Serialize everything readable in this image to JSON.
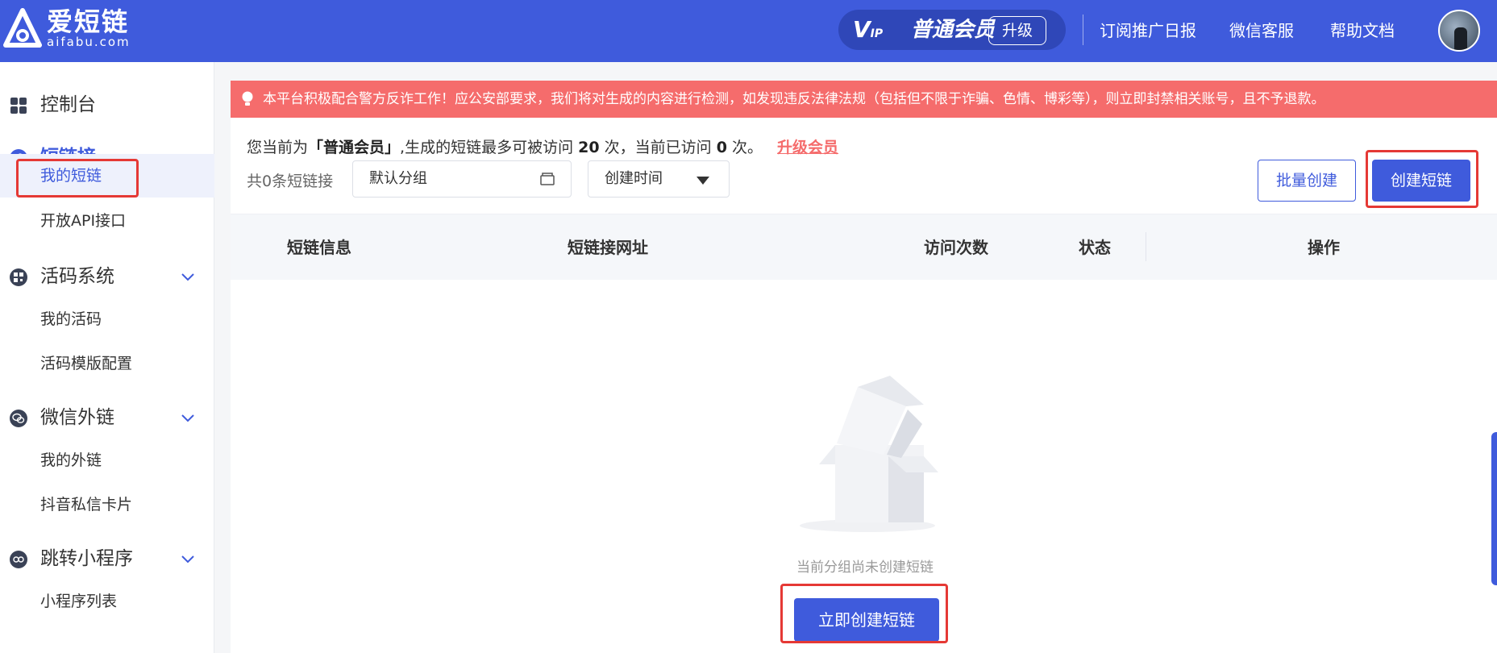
{
  "header": {
    "logo_cn": "爱短链",
    "logo_en": "aifabu.com",
    "vip_badge": "V",
    "vip_badge_small": "IP",
    "member_level": "普通会员",
    "upgrade_label": "升级",
    "links": [
      "订阅推广日报",
      "微信客服",
      "帮助文档"
    ]
  },
  "sidebar": {
    "groups": [
      {
        "label": "控制台",
        "icon": "dashboard-icon"
      },
      {
        "label": "短链接",
        "icon": "link-icon",
        "active": true,
        "items": [
          "我的短链",
          "开放API接口"
        ]
      },
      {
        "label": "活码系统",
        "icon": "qrcode-icon",
        "items": [
          "我的活码",
          "活码模版配置"
        ]
      },
      {
        "label": "微信外链",
        "icon": "wechat-icon",
        "items": [
          "我的外链",
          "抖音私信卡片"
        ]
      },
      {
        "label": "跳转小程序",
        "icon": "miniprogram-icon",
        "items": [
          "小程序列表"
        ]
      }
    ]
  },
  "notice": {
    "text": "本平台积极配合警方反诈工作！应公安部要求，我们将对生成的内容进行检测，如发现违反法律法规（包括但不限于诈骗、色情、博彩等），则立即封禁相关账号，且不予退款。"
  },
  "main": {
    "info_prefix": "您当前为",
    "info_level": "「普通会员」",
    "info_mid": ",生成的短链最多可被访问",
    "info_max": "20",
    "info_mid2": "次，当前已访问",
    "info_used": "0",
    "info_suffix": "次。",
    "upgrade_link": "升级会员",
    "count_label": "共0条短链接",
    "group_select": "默认分组",
    "sort_select": "创建时间",
    "batch_create": "批量创建",
    "create": "创建短链",
    "columns": [
      "短链信息",
      "短链接网址",
      "访问次数",
      "状态",
      "操作"
    ],
    "empty_text": "当前分组尚未创建短链",
    "create_now": "立即创建短链"
  },
  "colors": {
    "primary": "#3f5bdc",
    "notice": "#f56c6c",
    "highlight": "#e53935"
  }
}
